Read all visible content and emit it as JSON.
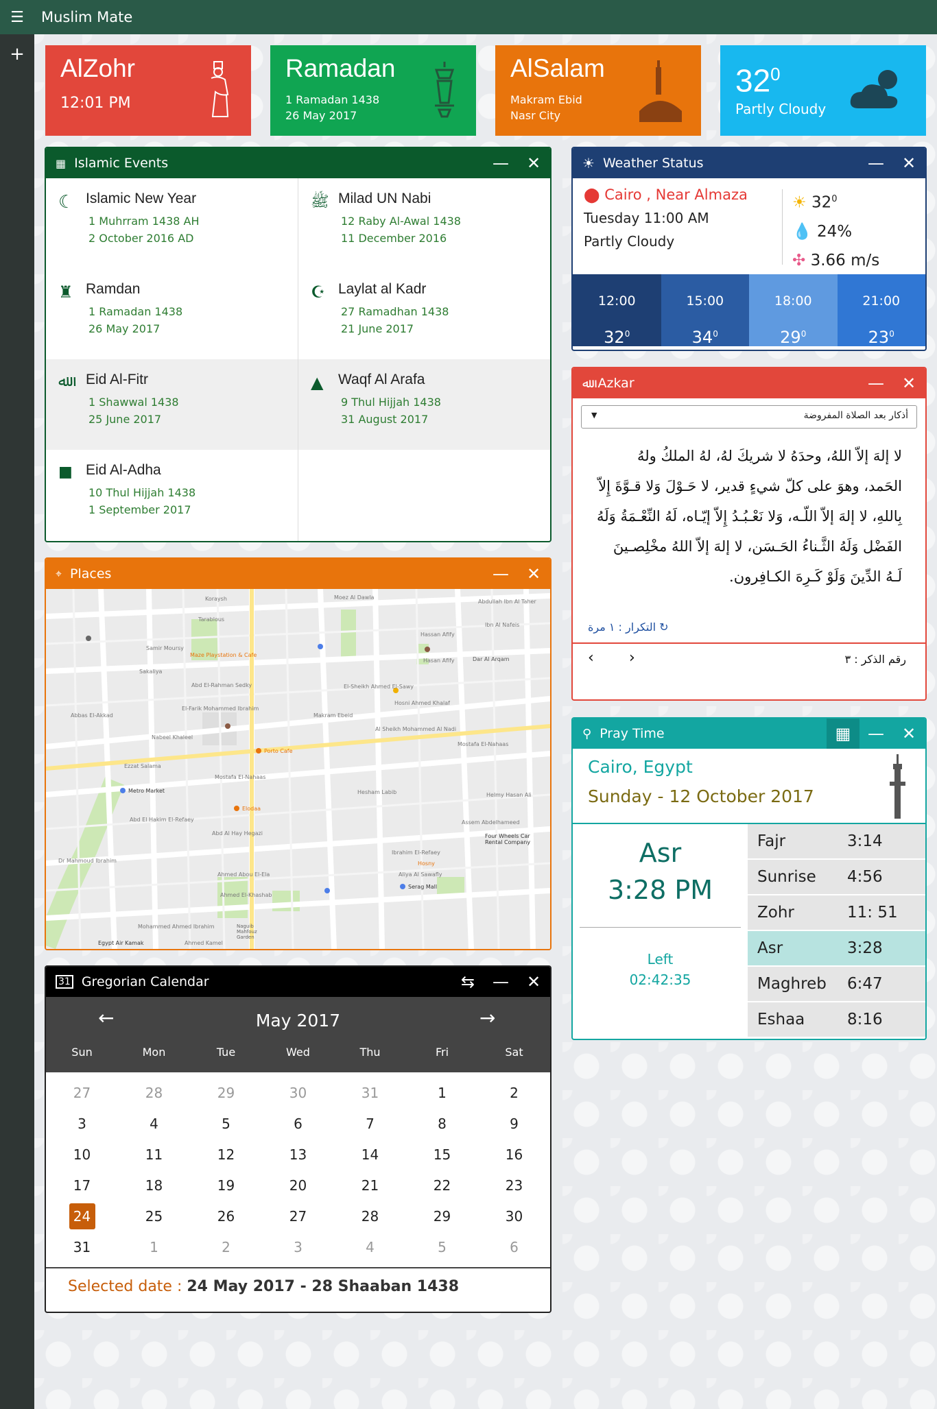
{
  "app": {
    "title": "Muslim Mate"
  },
  "tiles": {
    "zohr": {
      "title": "AlZohr",
      "time": "12:01 PM",
      "color": "#e2473b"
    },
    "ramadan": {
      "title": "Ramadan",
      "l1": "1 Ramadan 1438",
      "l2": "26 May 2017",
      "color": "#10a552"
    },
    "salam": {
      "title": "AlSalam",
      "l1": "Makram Ebid",
      "l2": "Nasr City",
      "color": "#e8740c"
    },
    "weather": {
      "temp": "32",
      "deg": "0",
      "desc": "Partly Cloudy",
      "color": "#18b8ef"
    }
  },
  "events": {
    "title": "Islamic Events",
    "items": [
      {
        "name": "Islamic New Year",
        "l1": "1 Muhrram 1438 AH",
        "l2": "2 October 2016 AD",
        "icon": "crescent-icon"
      },
      {
        "name": "Milad UN Nabi",
        "l1": "12 Raby Al-Awal 1438",
        "l2": "11 December 2016",
        "icon": "calligraphy-icon"
      },
      {
        "name": "Ramdan",
        "l1": "1 Ramadan 1438",
        "l2": "26 May 2017",
        "icon": "lantern-icon"
      },
      {
        "name": "Laylat al Kadr",
        "l1": "27 Ramadhan 1438",
        "l2": "21 June 2017",
        "icon": "crescent-mosque-icon"
      },
      {
        "name": "Eid Al-Fitr",
        "l1": "1 Shawwal 1438",
        "l2": "25 June 2017",
        "icon": "eid-calligraphy-icon"
      },
      {
        "name": "Waqf Al Arafa",
        "l1": "9 Thul Hijjah 1438",
        "l2": "31 August 2017",
        "icon": "mountain-icon"
      },
      {
        "name": "Eid Al-Adha",
        "l1": "10 Thul Hijjah 1438",
        "l2": "1 September 2017",
        "icon": "kaaba-icon"
      }
    ]
  },
  "weather": {
    "title": "Weather Status",
    "location": "Cairo , Near Almaza",
    "datetime": "Tuesday 11:00 AM",
    "desc": "Partly Cloudy",
    "temp": "32",
    "deg": "0",
    "humidity": "24%",
    "wind": "3.66 m/s",
    "forecast": [
      {
        "h": "12:00",
        "v": "32",
        "d": "0"
      },
      {
        "h": "15:00",
        "v": "34",
        "d": "0"
      },
      {
        "h": "18:00",
        "v": "29",
        "d": "0"
      },
      {
        "h": "21:00",
        "v": "23",
        "d": "0"
      }
    ]
  },
  "azkar": {
    "title": "Azkar",
    "select": "أذكار بعد الصلاة المفروضة",
    "text": "لا إلهَ إلاّ اللهُ، وحدَهُ لا شريكَ لهُ، لهُ الملكُ ولهُ الحَمد، وهوَ على كلّ شيءٍ قدير، لا حَـوْلَ وَلا قـوَّةَ إِلاّ بِاللهِ، لا إلهَ إلاّ اللّـه، وَلا نَعْـبُـدُ إِلاّ إيّـاه، لَهُ النِّعْـمَةُ وَلَهُ الفَضْل وَلَهُ الثَّـناءُ الحَـسَن، لا إلهَ إلاّ اللهُ مخْلِصـينَ لَـهُ الدِّينَ وَلَوْ كَـرِهَ الكـافِرون.",
    "repeat": "التكرار : ١ مرة",
    "number": "رقم الذكر : ٣"
  },
  "prayer": {
    "title": "Pray Time",
    "city": "Cairo, Egypt",
    "date": "Sunday - 12 October 2017",
    "current": "Asr",
    "current_time": "3:28 PM",
    "left_label": "Left",
    "left": "02:42:35",
    "times": [
      {
        "n": "Fajr",
        "t": "3:14"
      },
      {
        "n": "Sunrise",
        "t": "4:56"
      },
      {
        "n": "Zohr",
        "t": "11: 51"
      },
      {
        "n": "Asr",
        "t": "3:28"
      },
      {
        "n": "Maghreb",
        "t": "6:47"
      },
      {
        "n": "Eshaa",
        "t": "8:16"
      }
    ]
  },
  "places": {
    "title": "Places",
    "labels": [
      "Koraysh",
      "Moez Al Dawla",
      "Abdullah Ibn Al Taher",
      "Tarablous",
      "Ibn Al Nafeis",
      "Maze Playstation & Cafe",
      "Samir Moursy",
      "Sakaliya",
      "Hasan Afify",
      "Dar Al Arqam",
      "Abd El-Rahman Sedky",
      "El-Sheikh Ahmed El-Sawy",
      "El-Farik Mohammed Ibrahim",
      "Hosni Ahmed Khalaf",
      "Nabeel Khaleel",
      "Al Sheikh Mohammed Al Nadi",
      "Porto Cafe",
      "Mostafa El-Nahaas",
      "Metro Market",
      "Hesham Labib",
      "Elodaa",
      "Abd El Hakim El-Refaey",
      "Abd Al Hay Hegazi",
      "Ibrahim El-Refaey",
      "Hosny",
      "Four Wheels Car Rental Company",
      "Serag Mall",
      "Ahmed Abou El-Ela",
      "Mohammed Ahmed Ibrahim",
      "Ahmed Kamel",
      "Naguib Mahfouz Garden",
      "Egypt Air Kamak",
      "Makram Ebeid",
      "Abbas El-Akkad",
      "Ezzat Salama",
      "Aliya Al Sawafly",
      "Ahmed El-Khashab",
      "Dr Mahmoud Ibrahim",
      "Hassan Afify",
      "Assem Abdelhameed",
      "Helmy Hasan Ali",
      "Mostafa El-Nahaas"
    ]
  },
  "calendar": {
    "title": "Gregorian Calendar",
    "month": "May 2017",
    "weekdays": [
      "Sun",
      "Mon",
      "Tue",
      "Wed",
      "Thu",
      "Fri",
      "Sat"
    ],
    "weeks": [
      [
        "27",
        "28",
        "29",
        "30",
        "31",
        "1",
        "2"
      ],
      [
        "3",
        "4",
        "5",
        "6",
        "7",
        "8",
        "9"
      ],
      [
        "10",
        "11",
        "12",
        "13",
        "14",
        "15",
        "16"
      ],
      [
        "17",
        "18",
        "19",
        "20",
        "21",
        "22",
        "23"
      ],
      [
        "24",
        "25",
        "26",
        "27",
        "28",
        "29",
        "30"
      ],
      [
        "31",
        "1",
        "2",
        "3",
        "4",
        "5",
        "6"
      ]
    ],
    "selected_prefix": "Selected date :",
    "selected_value": "24 May 2017 -  28 Shaaban 1438"
  }
}
